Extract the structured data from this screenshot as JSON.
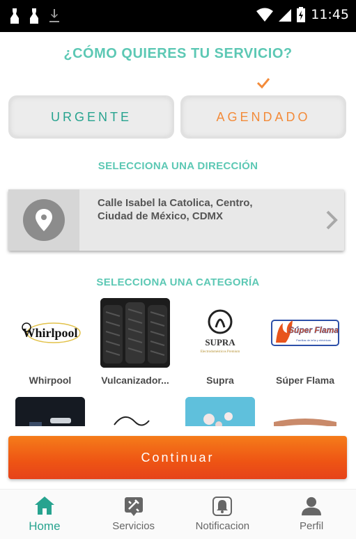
{
  "status_bar": {
    "time": "11:45"
  },
  "heading": "¿CÓMO QUIERES TU SERVICIO?",
  "options": {
    "urgente": "URGENTE",
    "agendado": "AGENDADO",
    "selected": "agendado"
  },
  "address_section": {
    "title": "SELECCIONA UNA DIRECCIÓN",
    "line1": "Calle Isabel la Catolica,  Centro,",
    "line2": "Ciudad de México,  CDMX"
  },
  "category_section": {
    "title": "SELECCIONA UNA CATEGORÍA",
    "categories": [
      {
        "label": "Whirpool",
        "logo_text": "Whirlpool"
      },
      {
        "label": "Vulcanizador..."
      },
      {
        "label": "Supra",
        "logo_text": "SUPRA",
        "logo_subtext": "Electrodomésticos Premium"
      },
      {
        "label": "Súper Flama",
        "logo_text": "Súper Flama",
        "logo_subtext": "Parrillas de leña y eléctricas"
      }
    ]
  },
  "continue_label": "Continuar",
  "bottom_nav": [
    {
      "label": "Home",
      "icon": "home-icon",
      "active": true
    },
    {
      "label": "Servicios",
      "icon": "tools-icon",
      "active": false
    },
    {
      "label": "Notificacion",
      "icon": "bell-icon",
      "active": false
    },
    {
      "label": "Perfil",
      "icon": "person-icon",
      "active": false
    }
  ],
  "colors": {
    "accent": "#5cc8b4",
    "urgent": "#27a38f",
    "agendado": "#f38b3a",
    "cta": "#ee5414"
  }
}
